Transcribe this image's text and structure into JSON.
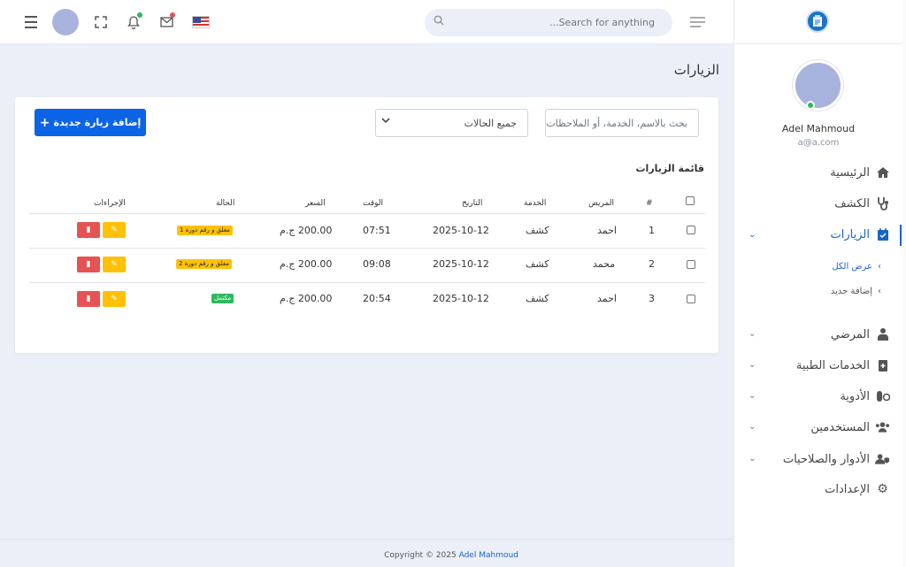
{
  "topbar": {
    "search_placeholder": "Search for anything...",
    "icons": [
      "menu-icon",
      "fullscreen-icon",
      "bell-icon",
      "mail-icon",
      "us-flag-icon",
      "sidebar-toggle-icon"
    ]
  },
  "sidebar": {
    "user_name": "Adel Mahmoud",
    "user_email": "a@a.com",
    "items": [
      {
        "label": "الرئيسية",
        "icon": "home-icon"
      },
      {
        "label": "الكشف",
        "icon": "stethoscope-icon"
      },
      {
        "label": "الزيارات",
        "icon": "calendar-check-icon",
        "active": true
      },
      {
        "label": "المرضي",
        "icon": "patient-icon"
      },
      {
        "label": "الخدمات الطبية",
        "icon": "medical-kit-icon"
      },
      {
        "label": "الأدوية",
        "icon": "pills-icon"
      },
      {
        "label": "المستخدمين",
        "icon": "users-icon"
      },
      {
        "label": "الأدوار والصلاحيات",
        "icon": "user-shield-icon"
      },
      {
        "label": "الإعدادات",
        "icon": "gear-icon"
      }
    ],
    "subitems": [
      {
        "label": "عرض الكل",
        "active": true
      },
      {
        "label": "إضافة جديد"
      }
    ]
  },
  "main": {
    "title": "الزيارات",
    "add_button": "إضافة زيارة جديدة",
    "status_filter": "جميع الحالات",
    "search_placeholder": "بحث بالاسم، الخدمة، أو الملاحظات",
    "table_title": "قائمة الزيارات",
    "columns": [
      "#",
      "المريض",
      "الخدمة",
      "التاريخ",
      "الوقت",
      "السعر",
      "الحالة",
      "الإجراءات"
    ],
    "rows": [
      {
        "num": "1",
        "patient": "احمد",
        "service": "كشف",
        "date": "2025-10-12",
        "time": "07:51",
        "price": "200.00 ج.م",
        "status": "مغلق و رقم دورة 1",
        "status_type": "warning"
      },
      {
        "num": "2",
        "patient": "محمد",
        "service": "كشف",
        "date": "2025-10-12",
        "time": "09:08",
        "price": "200.00 ج.م",
        "status": "مغلق و رقم دورة 2",
        "status_type": "warning"
      },
      {
        "num": "3",
        "patient": "احمد",
        "service": "كشف",
        "date": "2025-10-12",
        "time": "20:54",
        "price": "200.00 ج.م",
        "status": "مكتمل",
        "status_type": "success"
      }
    ]
  },
  "footer": {
    "copyright": "Copyright © 2025",
    "author": "Adel Mahmoud"
  },
  "colors": {
    "primary": "#0b63e5",
    "warning": "#ffc107",
    "danger": "#e55353",
    "success": "#2eb85c",
    "background": "#ebeff8"
  }
}
